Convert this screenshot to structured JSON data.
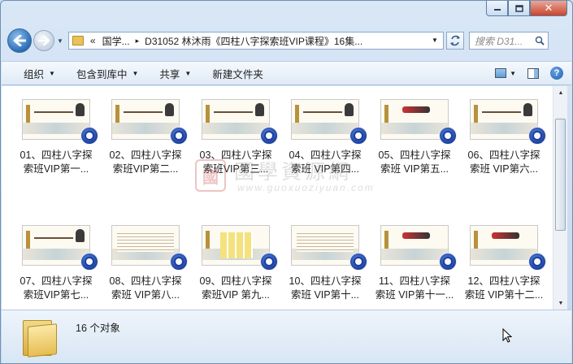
{
  "window": {
    "caption_buttons": [
      "minimize",
      "maximize",
      "close"
    ],
    "close_glyph": "✕"
  },
  "nav": {
    "address_prefix": "«",
    "address_segment1": "国学...",
    "address_separator": "▸",
    "address_segment2": "D31052 林沐雨《四柱八字探索班VIP课程》16集...",
    "search_placeholder": "搜索 D31..."
  },
  "toolbar": {
    "organize": "组织",
    "include_library": "包含到库中",
    "share": "共享",
    "new_folder": "新建文件夹"
  },
  "files": [
    {
      "line1": "01、四柱八字探",
      "line2": "索班VIP第一..."
    },
    {
      "line1": "02、四柱八字探",
      "line2": "索班VIP第二..."
    },
    {
      "line1": "03、四柱八字探",
      "line2": "索班VIP第三..."
    },
    {
      "line1": "04、四柱八字探",
      "line2": "索班 VIP第四..."
    },
    {
      "line1": "05、四柱八字探",
      "line2": "索班 VIP第五..."
    },
    {
      "line1": "06、四柱八字探",
      "line2": "索班 VIP第六..."
    },
    {
      "line1": "07、四柱八字探",
      "line2": "索班VIP第七..."
    },
    {
      "line1": "08、四柱八字探",
      "line2": "索班 VIP第八..."
    },
    {
      "line1": "09、四柱八字探",
      "line2": "索班VIP 第九..."
    },
    {
      "line1": "10、四柱八字探",
      "line2": "索班  VIP第十..."
    },
    {
      "line1": "11、四柱八字探",
      "line2": "索班 VIP第十一..."
    },
    {
      "line1": "12、四柱八字探",
      "line2": "索班 VIP第十二..."
    }
  ],
  "watermark": {
    "seal": "國",
    "title": "國學資源網",
    "url": "www.guoxuoziyuan.com"
  },
  "details": {
    "count_text": "16 个对象"
  },
  "colors": {
    "accent": "#2b6cb7",
    "close_button": "#c9452c",
    "folder": "#e6bd52",
    "toolbar_bg": "#dfeaf6"
  },
  "icons": [
    "back-arrow-icon",
    "forward-arrow-icon",
    "folder-icon",
    "refresh-icon",
    "search-icon",
    "view-icon",
    "preview-pane-icon",
    "help-icon",
    "video-reel-icon",
    "cursor-icon"
  ]
}
